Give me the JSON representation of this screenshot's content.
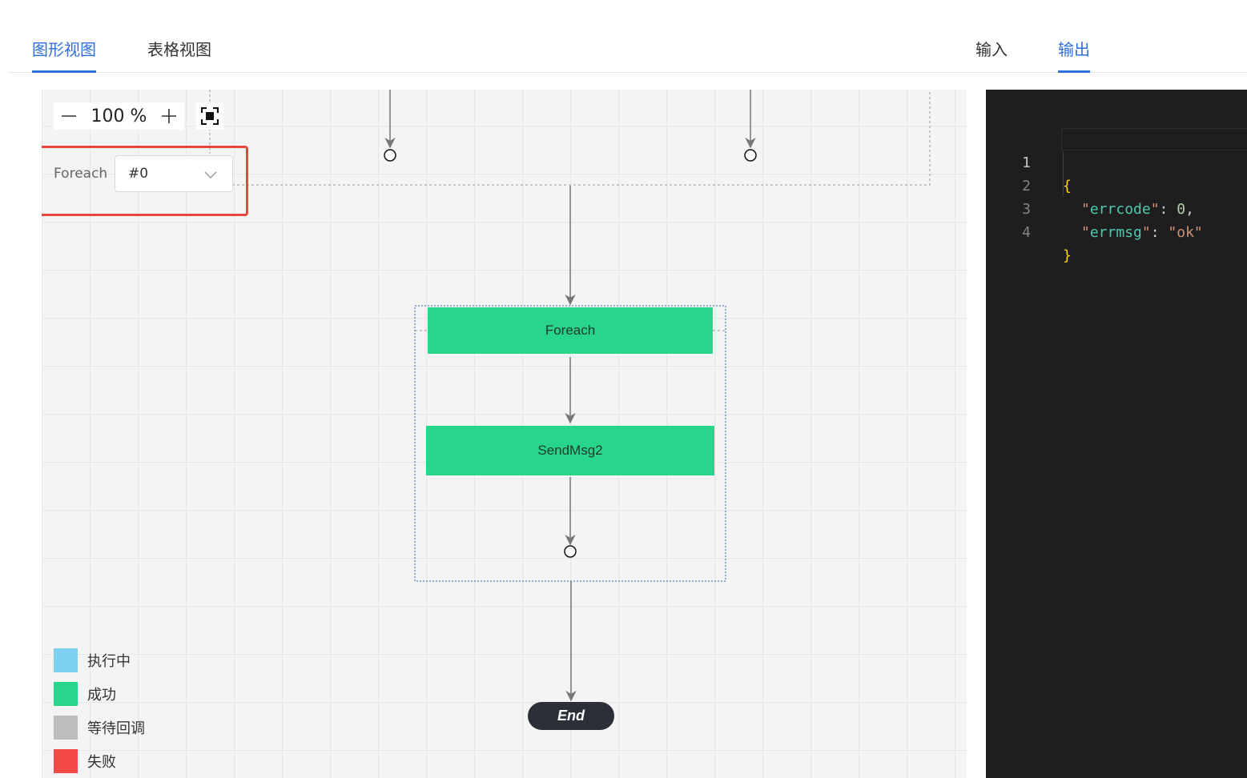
{
  "tabs": {
    "graph_view": "图形视图",
    "table_view": "表格视图",
    "input": "输入",
    "output": "输出"
  },
  "zoom": {
    "minus": "—",
    "value": "100 %",
    "plus": "+"
  },
  "foreach_selector": {
    "label": "Foreach",
    "selected": "#0"
  },
  "nodes": {
    "foreach": "Foreach",
    "sendmsg": "SendMsg2",
    "end": "End"
  },
  "legend": [
    {
      "label": "执行中",
      "color": "#7ed0ef"
    },
    {
      "label": "成功",
      "color": "#27d68b"
    },
    {
      "label": "等待回调",
      "color": "#bdbdbd"
    },
    {
      "label": "失败",
      "color": "#f54848"
    }
  ],
  "code_panel": {
    "lines": [
      {
        "num": "1",
        "brace": "{"
      },
      {
        "num": "2",
        "key": "errcode",
        "value": "0",
        "trail": ","
      },
      {
        "num": "3",
        "key": "errmsg",
        "value": "\"ok\""
      },
      {
        "num": "4",
        "brace": "}"
      }
    ]
  },
  "colors": {
    "accent": "#2f6fdc",
    "success": "#27d68b",
    "highlight_border": "#e8453c",
    "code_bg": "#1e1e1e"
  }
}
